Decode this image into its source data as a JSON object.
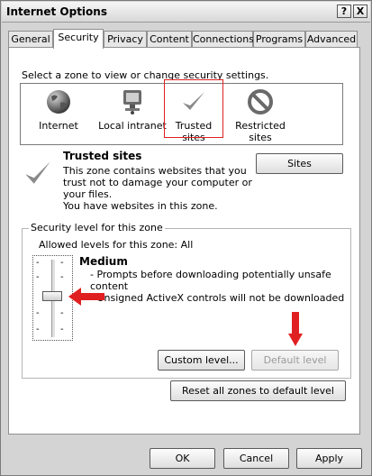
{
  "window": {
    "title": "Internet Options",
    "help_label": "?",
    "close_label": "X"
  },
  "tabs": [
    {
      "label": "General"
    },
    {
      "label": "Security"
    },
    {
      "label": "Privacy"
    },
    {
      "label": "Content"
    },
    {
      "label": "Connections"
    },
    {
      "label": "Programs"
    },
    {
      "label": "Advanced"
    }
  ],
  "active_tab": "Security",
  "zones": {
    "prompt": "Select a zone to view or change security settings.",
    "items": [
      {
        "label": "Internet",
        "icon": "globe-icon"
      },
      {
        "label": "Local intranet",
        "icon": "computer-network-icon"
      },
      {
        "label": "Trusted sites",
        "icon": "checkmark-icon"
      },
      {
        "label": "Restricted sites",
        "icon": "prohibited-icon"
      }
    ],
    "selected": "Trusted sites"
  },
  "zone_info": {
    "title": "Trusted sites",
    "description_line1": "This zone contains websites that you",
    "description_line2": "trust not to damage your computer or",
    "description_line3": "your files.",
    "description_line4": "You have websites in this zone.",
    "sites_button": "Sites"
  },
  "security_level": {
    "group_label": "Security level for this zone",
    "allowed_levels": "Allowed levels for this zone: All",
    "level_name": "Medium",
    "bullet1_line1": "- Prompts before downloading potentially unsafe",
    "bullet1_line2": "content",
    "bullet2": "- Unsigned ActiveX controls will not be downloaded",
    "slider_level": 0.5,
    "custom_level_button": "Custom level...",
    "default_level_button": "Default level",
    "reset_button": "Reset all zones to default level"
  },
  "footer": {
    "ok": "OK",
    "cancel": "Cancel",
    "apply": "Apply"
  },
  "colors": {
    "annotation_red": "#e02020",
    "selection_outline": "#e02020"
  }
}
